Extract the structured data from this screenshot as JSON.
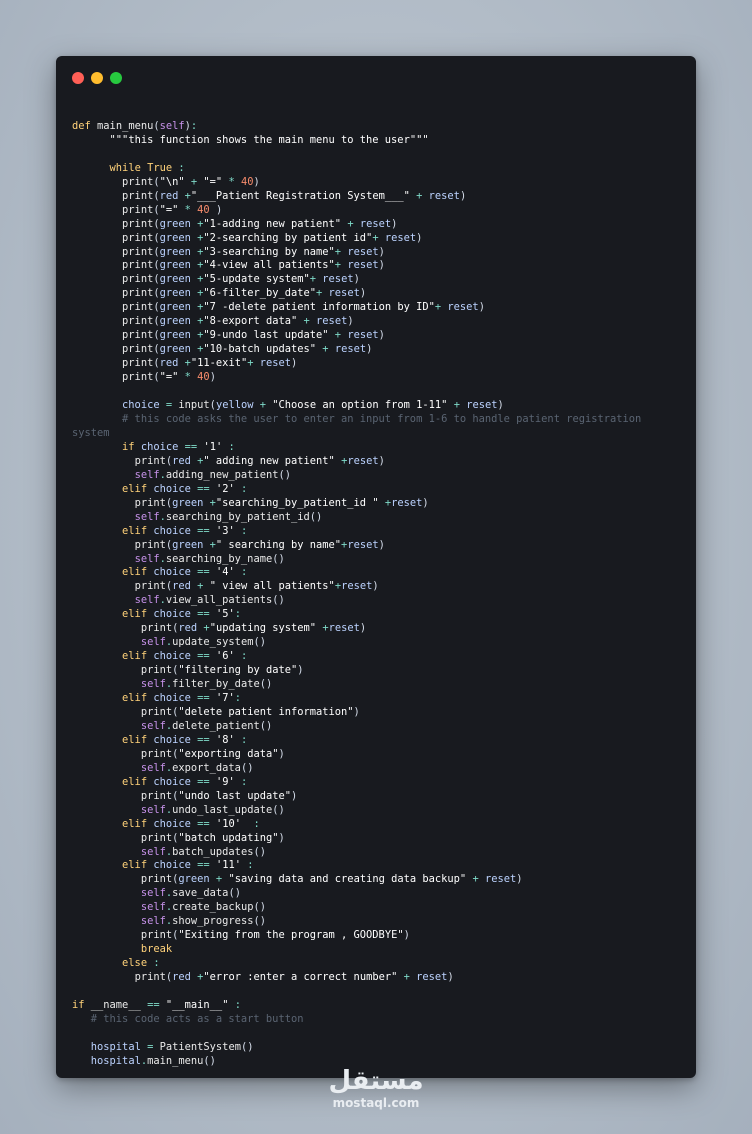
{
  "window": {
    "controls": [
      {
        "name": "close",
        "color": "#ff5f56"
      },
      {
        "name": "minimize",
        "color": "#ffbd2e"
      },
      {
        "name": "maximize",
        "color": "#27c93f"
      }
    ]
  },
  "code": {
    "lines": [
      "",
      "def main_menu(self):",
      "      \"\"\"this function shows the main menu to the user\"\"\"",
      "",
      "      while True :",
      "        print(\"\\n\" + \"=\" * 40)",
      "        print(red +\"___Patient Registration System___\" + reset)",
      "        print(\"=\" * 40 )",
      "        print(green +\"1-adding new patient\" + reset)",
      "        print(green +\"2-searching by patient id\"+ reset)",
      "        print(green +\"3-searching by name\"+ reset)",
      "        print(green +\"4-view all patients\"+ reset)",
      "        print(green +\"5-update system\"+ reset)",
      "        print(green +\"6-filter_by_date\"+ reset)",
      "        print(green +\"7 -delete patient information by ID\"+ reset)",
      "        print(green +\"8-export data\" + reset)",
      "        print(green +\"9-undo last update\" + reset)",
      "        print(green +\"10-batch updates\" + reset)",
      "        print(red +\"11-exit\"+ reset)",
      "        print(\"=\" * 40)",
      "",
      "        choice = input(yellow + \"Choose an option from 1-11\" + reset)",
      "        # this code asks the user to enter an input from 1-6 to handle patient registration",
      "system",
      "        if choice == '1' :",
      "          print(red +\" adding new patient\" +reset)",
      "          self.adding_new_patient()",
      "        elif choice == '2' :",
      "          print(green +\"searching_by_patient_id \" +reset)",
      "          self.searching_by_patient_id()",
      "        elif choice == '3' :",
      "          print(green +\" searching by name\"+reset)",
      "          self.searching_by_name()",
      "        elif choice == '4' :",
      "          print(red + \" view all patients\"+reset)",
      "          self.view_all_patients()",
      "        elif choice == '5':",
      "           print(red +\"updating system\" +reset)",
      "           self.update_system()",
      "        elif choice == '6' :",
      "           print(\"filtering by date\")",
      "           self.filter_by_date()",
      "        elif choice == '7':",
      "           print(\"delete patient information\")",
      "           self.delete_patient()",
      "        elif choice == '8' :",
      "           print(\"exporting data\")",
      "           self.export_data()",
      "        elif choice == '9' :",
      "           print(\"undo last update\")",
      "           self.undo_last_update()",
      "        elif choice == '10'  :",
      "           print(\"batch updating\")",
      "           self.batch_updates()",
      "        elif choice == '11' :",
      "           print(green + \"saving data and creating data backup\" + reset)",
      "           self.save_data()",
      "           self.create_backup()",
      "           self.show_progress()",
      "           print(\"Exiting from the program , GOODBYE\")",
      "           break",
      "        else :",
      "          print(red +\"error :enter a correct number\" + reset)",
      "",
      "if __name__ == \"__main__\" :",
      "   # this code acts as a start button",
      "",
      "   hospital = PatientSystem()",
      "   hospital.main_menu()"
    ]
  },
  "watermark": {
    "arabic": "مستقل",
    "latin": "mostaql.com"
  }
}
